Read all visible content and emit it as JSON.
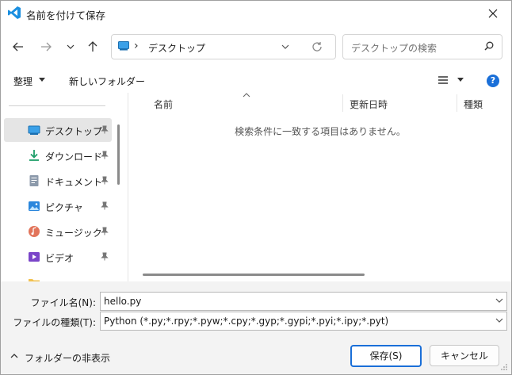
{
  "window": {
    "title": "名前を付けて保存",
    "app_icon": "vscode-icon",
    "accent": "#1a6fd8"
  },
  "nav": {
    "back_icon": "arrow-left-icon",
    "forward_icon": "arrow-right-icon",
    "recent_icon": "chevron-down-icon",
    "up_icon": "arrow-up-icon"
  },
  "address": {
    "separator": "›",
    "location": "デスクトップ"
  },
  "search": {
    "placeholder": "デスクトップの検索"
  },
  "commands": {
    "organize": "整理",
    "new_folder": "新しいフォルダー"
  },
  "sidebar": {
    "items": [
      {
        "label": "デスクトップ",
        "icon": "desktop-icon",
        "selected": true
      },
      {
        "label": "ダウンロード",
        "icon": "download-icon"
      },
      {
        "label": "ドキュメント",
        "icon": "document-icon"
      },
      {
        "label": "ピクチャ",
        "icon": "picture-icon"
      },
      {
        "label": "ミュージック",
        "icon": "music-icon"
      },
      {
        "label": "ビデオ",
        "icon": "video-icon"
      }
    ]
  },
  "file_list": {
    "columns": [
      "名前",
      "更新日時",
      "種類"
    ],
    "empty_message": "検索条件に一致する項目はありません。"
  },
  "form": {
    "filename_label": "ファイル名(N):",
    "filename_value": "hello.py",
    "filetype_label": "ファイルの種類(T):",
    "filetype_value": "Python (*.py;*.rpy;*.pyw;*.cpy;*.gyp;*.gypi;*.pyi;*.ipy;*.pyt)"
  },
  "footer": {
    "hide_folders": "フォルダーの非表示",
    "save_button": "保存(S)",
    "cancel_button": "キャンセル"
  }
}
